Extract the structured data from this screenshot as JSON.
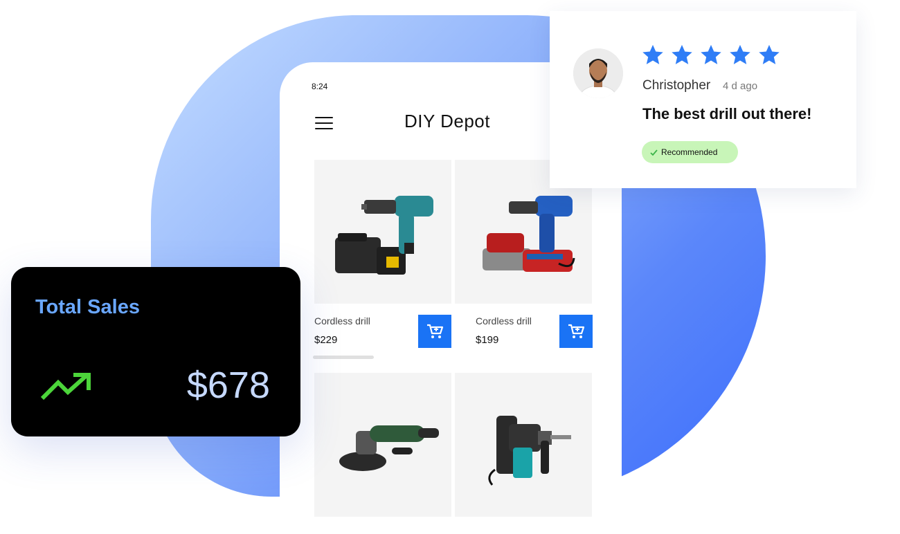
{
  "phone": {
    "status_time": "8:24",
    "app_title": "DIY Depot"
  },
  "products": [
    {
      "name": "Cordless drill",
      "price": "$229",
      "image_icon": "cordless-drill-teal"
    },
    {
      "name": "Cordless drill",
      "price": "$199",
      "image_icon": "cordless-drill-blue"
    },
    {
      "name": "",
      "price": "",
      "image_icon": "angle-grinder"
    },
    {
      "name": "",
      "price": "",
      "image_icon": "rotary-hammer"
    }
  ],
  "review": {
    "rating": 5,
    "reviewer_name": "Christopher",
    "time_ago": "4 d ago",
    "text": "The best drill out there!",
    "badge": "Recommended"
  },
  "sales": {
    "title": "Total Sales",
    "value": "$678"
  },
  "colors": {
    "accent_blue": "#1a73f5",
    "star_blue": "#2f7df6",
    "trend_green": "#4cd53a",
    "badge_green": "#c8f5b8",
    "sales_title_blue": "#6aa7ff"
  }
}
